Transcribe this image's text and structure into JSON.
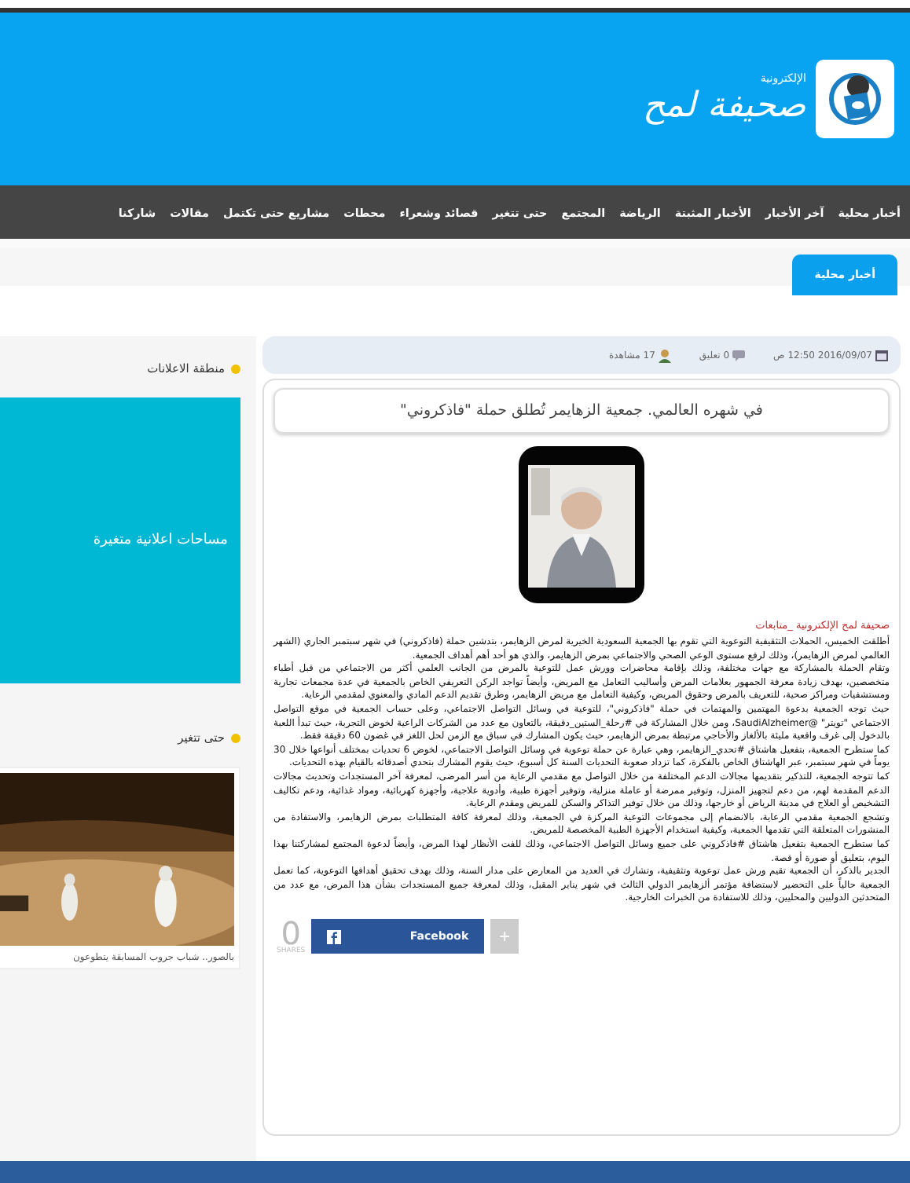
{
  "header": {
    "logo_title": "صحيفة لمح",
    "logo_subtitle": "الإلكترونية"
  },
  "nav": [
    {
      "label": "أخبار محلية"
    },
    {
      "label": "آخر الأخبار"
    },
    {
      "label": "الأخبار المثبتة"
    },
    {
      "label": "الرياضة"
    },
    {
      "label": "المجتمع"
    },
    {
      "label": "حتى تتغير"
    },
    {
      "label": "قصائد وشعراء"
    },
    {
      "label": "محطات"
    },
    {
      "label": "مشاريع حتى تكتمل"
    },
    {
      "label": "مقالات"
    },
    {
      "label": "شاركنا"
    }
  ],
  "breadcrumb": "أخبار محلية",
  "article": {
    "date": "2016/09/07 12:50 ص",
    "comments": "0 تعليق",
    "views": "17 مشاهدة",
    "title": "في شهره العالمي. جمعية الزهايمر تُطلق حملة \"فاذكروني\"",
    "source": "صحيفة لمح الإلكترونية _متابعات",
    "paragraphs": [
      "أطلقت الخميس، الحملات التثقيفية التوعوية التي تقوم بها الجمعية السعودية الخيرية لمرض الزهايمر، بتدشين حملة (فاذكروني) في شهر سبتمبر الجاري (الشهر العالمي لمرض الزهايمر)، وذلك لرفع مستوى الوعي الصحي والاجتماعي بمرض الزهايمر، والذي هو أحد أهم أهداف الجمعية.",
      "وتقام الحملة بالمشاركة مع جهات مختلفة، وذلك بإقامة محاضرات وورش عمل للتوعية بالمرض من الجانب العلمي أكثر من الاجتماعي من قبل أطباء متخصصين، بهدف زيادة معرفة الجمهور بعلامات المرض وأساليب التعامل مع المريض، وأيضاً تواجد الركن التعريفي الخاص بالجمعية في عدة مجمعات تجارية ومستشفيات ومراكز صحية، للتعريف بالمرض وحقوق المريض، وكيفية التعامل مع مريض الزهايمر، وطرق تقديم الدعم المادي والمعنوي لمقدمي الرعاية.",
      "حيث توجه الجمعية بدعوة المهتمين والمهتمات في حملة \"فاذكروني\"، للتوعية في وسائل التواصل الاجتماعي، وعلى حساب الجمعية في موقع التواصل الاجتماعي \"تويتر\" @SaudiAlzheimer، ومن خلال المشاركة في #رحلة_الستين_دقيقة، بالتعاون مع عدد من الشركات الراعية لخوض التجربة، حيث تبدأ اللعبة بالدخول إلى غرف واقعية مليئة بالألغاز والأحاجي مرتبطة بمرض الزهايمر، حيث يكون المشارك في سباق مع الزمن لحل اللغز في غضون 60 دقيقة فقط.",
      "كما ستطرح الجمعية، بتفعيل هاشتاق #تحدي_الزهايمر، وهي عبارة عن حملة توعوية في وسائل التواصل الاجتماعي، لخوض 6 تحديات بمختلف أنواعها خلال 30 يوماً في شهر سبتمبر، عبر الهاشتاق الخاص بالفكرة، كما تزداد صعوبة التحديات السنة كل أسبوع، حيث يقوم المشارك بتحدي أصدقائه بالقيام بهذه التحديات.",
      "كما تتوجه الجمعية، للتذكير بتقديمها مجالات الدعم المختلفة من خلال التواصل مع مقدمي الرعاية من أسر المرضى، لمعرفة آخر المستجدات وتحديث مجالات الدعم المقدمة لهم، من دعم لتجهيز المنزل، وتوفير ممرضة أو عاملة منزلية، وتوفير أجهزة طبية، وأدوية علاجية، وأجهزة كهربائية، ومواد غذائية، ودعم تكاليف التشخيص أو العلاج في مدينة الرياض أو خارجها، وذلك من خلال توفير التذاكر والسكن للمريض ومقدم الرعاية.",
      "وتشجع الجمعية مقدمي الرعاية، بالانضمام إلى مجموعات التوعية المركزة في الجمعية، وذلك لمعرفة كافة المتطلبات بمرض الزهايمر، والاستفادة من المنشورات المتعلقة التي تقدمها الجمعية، وكيفية استخدام الأجهزة الطبية المخصصة للمريض.",
      "كما ستطرح الجمعية بتفعيل هاشتاق #فاذكروني على جميع وسائل التواصل الاجتماعي، وذلك للفت الأنظار لهذا المرض، وأيضاً لدعوة المجتمع لمشاركتنا بهذا اليوم، بتعليق أو صورة أو قصة.",
      "الجدير بالذكر، أن الجمعية تقيم ورش عمل توعوية وتثقيفية، وتشارك في العديد من المعارض على مدار السنة، وذلك بهدف تحقيق أهدافها التوعوية، كما تعمل الجمعية حالياً على التحضير لاستضافة مؤتمر ألزهايمر الدولي الثالث في شهر يناير المقبل، وذلك لمعرفة جميع المستجدات بشأن هذا المرض، مع عدد من المتحدثين الدوليين والمحليين، وذلك للاستفادة من الخبرات الخارجية."
    ],
    "share": {
      "count": "0",
      "label": "SHARES",
      "facebook": "Facebook",
      "more": "+"
    }
  },
  "sidebar": [
    {
      "kind": "ad",
      "title": "منطقة الاعلانات",
      "text": "مساحات اعلانية متغيرة"
    },
    {
      "kind": "news",
      "title": "حتى تتغير",
      "caption": "بالصور.. شباب جروب المسابقة يتطوعون"
    }
  ]
}
